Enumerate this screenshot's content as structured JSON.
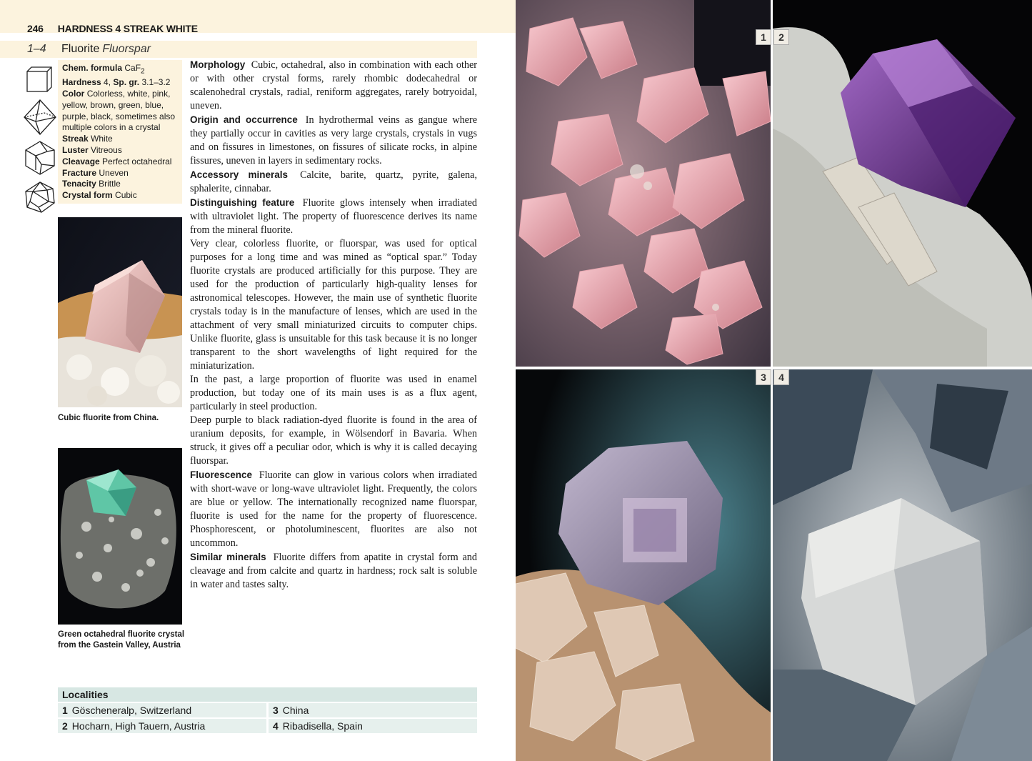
{
  "header": {
    "page_number": "246",
    "running_head": "HARDNESS 4 STREAK WHITE"
  },
  "title": {
    "range": "1–4",
    "name": "Fluorite",
    "alt_name": "Fluorspar"
  },
  "icons": [
    "cube-icon",
    "octahedron-icon",
    "dodecahedron-icon",
    "icosahedron-icon"
  ],
  "properties": {
    "formula_label": "Chem. formula",
    "formula_value": "CaF",
    "formula_sub": "2",
    "hardness_label": "Hardness",
    "hardness_value": "4,",
    "sg_label": "Sp. gr.",
    "sg_value": "3.1–3.2",
    "color_label": "Color",
    "color_value": "Colorless, white, pink, yellow, brown, green, blue, purple, black, sometimes also multiple colors in a crystal",
    "streak_label": "Streak",
    "streak_value": "White",
    "luster_label": "Luster",
    "luster_value": "Vitreous",
    "cleavage_label": "Cleavage",
    "cleavage_value": "Perfect octahedral",
    "fracture_label": "Fracture",
    "fracture_value": "Uneven",
    "tenacity_label": "Tenacity",
    "tenacity_value": "Brittle",
    "form_label": "Crystal form",
    "form_value": "Cubic"
  },
  "captions": {
    "photo1": "Cubic fluorite from China.",
    "photo2": "Green octahedral fluorite crystal from the Gastein Valley, Austria"
  },
  "body": {
    "morph_h": "Morphology",
    "morph": "Cubic, octahedral, also in combination with each other or with other crystal forms, rarely rhombic dodecahedral or scalenohedral crystals, radial, reniform aggregates, rarely botryoidal, uneven.",
    "origin_h": "Origin and occurrence",
    "origin": "In hydrothermal veins as gangue where they partially occur in cavities as very large crystals, crystals in vugs and on fissures in limestones, on fissures of silicate rocks, in alpine fissures, uneven in layers in sedimentary rocks.",
    "acc_h": "Accessory minerals",
    "acc": "Calcite, barite, quartz, pyrite, galena, sphalerite, cinnabar.",
    "dist_h": "Distinguishing feature",
    "dist": "Fluorite glows intensely when irradiated with ultraviolet light. The property of fluorescence derives its name from the mineral fluorite.",
    "p1": "Very clear, colorless fluorite, or fluorspar, was used for optical purposes for a long time and was mined as “optical spar.” Today fluorite crystals are produced artificially for this purpose. They are used for the production of particularly high-quality lenses for astronomical telescopes. However, the main use of synthetic fluorite crystals today is in the manufacture of lenses, which are used in the attachment of very small miniaturized circuits to computer chips. Unlike fluorite, glass is unsuitable for this task because it is no longer transparent to the short wavelengths of light required for the miniaturization.",
    "p2": "In the past, a large proportion of fluorite was used in enamel production, but today one of its main uses is as a flux agent, particularly in steel production.",
    "p3": "Deep purple to black radiation-dyed fluorite is found in the area of uranium deposits, for example, in Wölsendorf in Bavaria. When struck, it gives off a peculiar odor, which is why it is called decaying fluorspar.",
    "fluor_h": "Fluorescence",
    "fluor": "Fluorite can glow in various colors when irradiated with short-wave or long-wave ultraviolet light. Frequently, the colors are blue or yellow. The internationally recognized name fluorspar, fluorite is used for the name for the property of fluorescence. Phosphorescent, or photoluminescent, fluorites are also not uncommon.",
    "sim_h": "Similar minerals",
    "sim": "Fluorite differs from apatite in crystal form and cleavage and from calcite and quartz in hardness; rock salt is soluble in water and tastes salty."
  },
  "localities": {
    "title": "Localities",
    "items": [
      {
        "n": "1",
        "name": "Göscheneralp, Switzerland"
      },
      {
        "n": "3",
        "name": "China"
      },
      {
        "n": "2",
        "name": "Hocharn, High Tauern, Austria"
      },
      {
        "n": "4",
        "name": "Ribadisella, Spain"
      }
    ]
  },
  "plates": {
    "b1": "1",
    "b2": "2",
    "b3": "3",
    "b4": "4"
  }
}
